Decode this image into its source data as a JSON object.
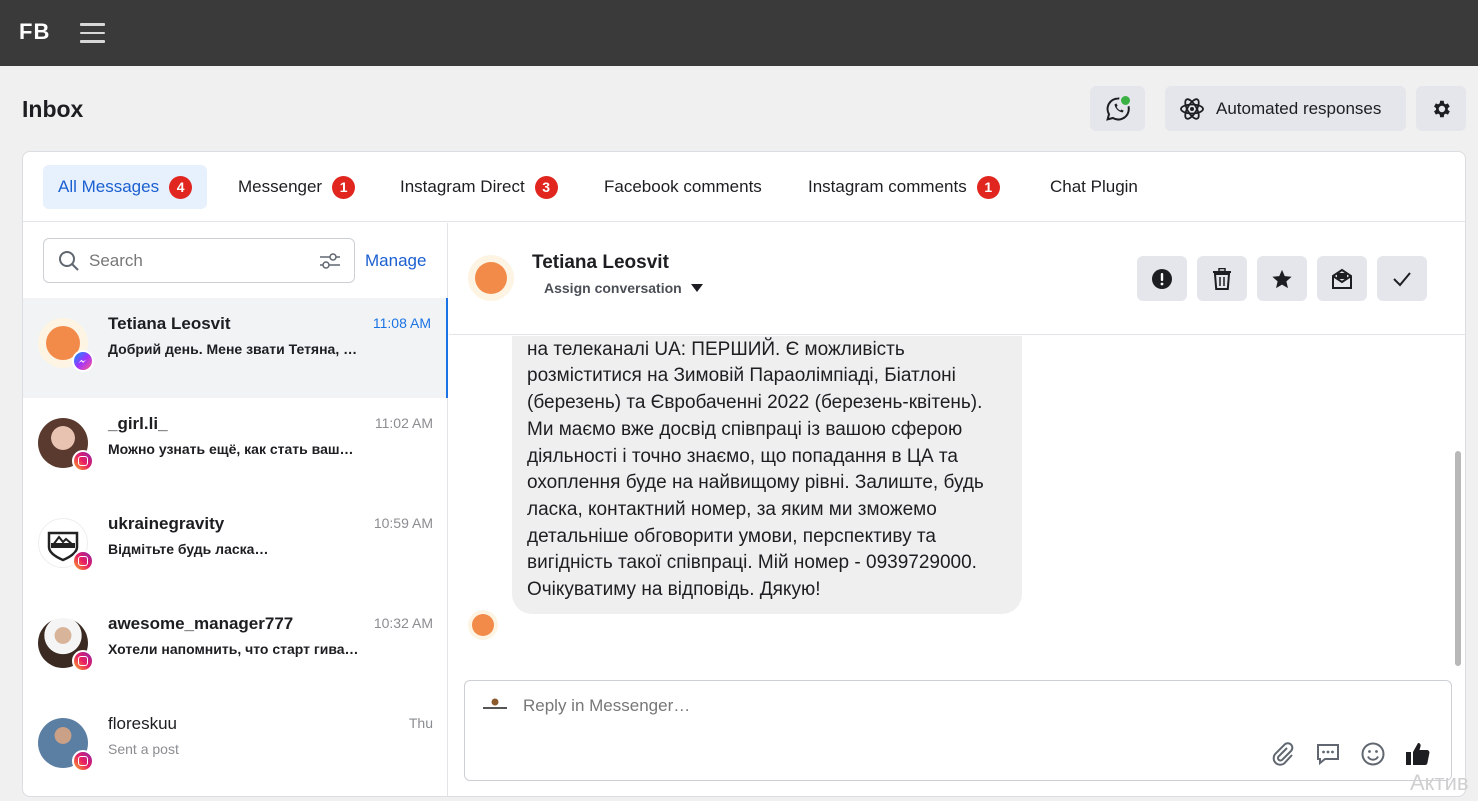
{
  "topbar": {
    "logo": "FB"
  },
  "page": {
    "title": "Inbox"
  },
  "header_actions": {
    "automated_responses": "Automated responses"
  },
  "tabs": [
    {
      "label": "All Messages",
      "badge": "4"
    },
    {
      "label": "Messenger",
      "badge": "1"
    },
    {
      "label": "Instagram Direct",
      "badge": "3"
    },
    {
      "label": "Facebook comments",
      "badge": ""
    },
    {
      "label": "Instagram comments",
      "badge": "1"
    },
    {
      "label": "Chat Plugin",
      "badge": ""
    }
  ],
  "search": {
    "placeholder": "Search",
    "manage": "Manage"
  },
  "conversations": [
    {
      "name": "Tetiana Leosvit",
      "time": "11:08 AM",
      "preview": "Добрий день. Мене звати Тетяна, …",
      "platform": "messenger-icon"
    },
    {
      "name": "_girl.li_",
      "time": "11:02 AM",
      "preview": "Можно узнать ещё, как стать ваш…",
      "platform": "instagram-icon"
    },
    {
      "name": "ukrainegravity",
      "time": "10:59 AM",
      "preview": "Відмітьте будь ласка…",
      "platform": "instagram-icon"
    },
    {
      "name": "awesome_manager777",
      "time": "10:32 AM",
      "preview": "Хотели напомнить, что старт гива…",
      "platform": "instagram-icon"
    },
    {
      "name": "floreskuu",
      "time": "Thu",
      "preview": "Sent a post",
      "platform": "instagram-icon"
    }
  ],
  "chat": {
    "name": "Tetiana Leosvit",
    "assign": "Assign conversation",
    "message": "спонсорському розміщенню на телебаченні. А саме - на телеканалі UA: ПЕРШИЙ. Є можливість розміститися на Зимовій Параолімпіаді, Біатлоні (березень) та Євробаченні 2022 (березень-квітень). Ми маємо вже досвід співпраці із вашою сферою діяльності і точно знаємо, що попадання в ЦА та охоплення буде на найвищому рівні. Залиште, будь ласка, контактний номер, за яким ми зможемо детальніше обговорити умови, перспективу та вигідність такої співпраці. Мій номер - 0939729000. Очікуватиму на відповідь. Дякую!"
  },
  "composer": {
    "placeholder": "Reply in Messenger…"
  },
  "watermark": "Актив",
  "colors": {
    "accent": "#1b74e4",
    "badge": "#e0261f",
    "topbar": "#3a3a3a",
    "online": "#3bb143"
  }
}
